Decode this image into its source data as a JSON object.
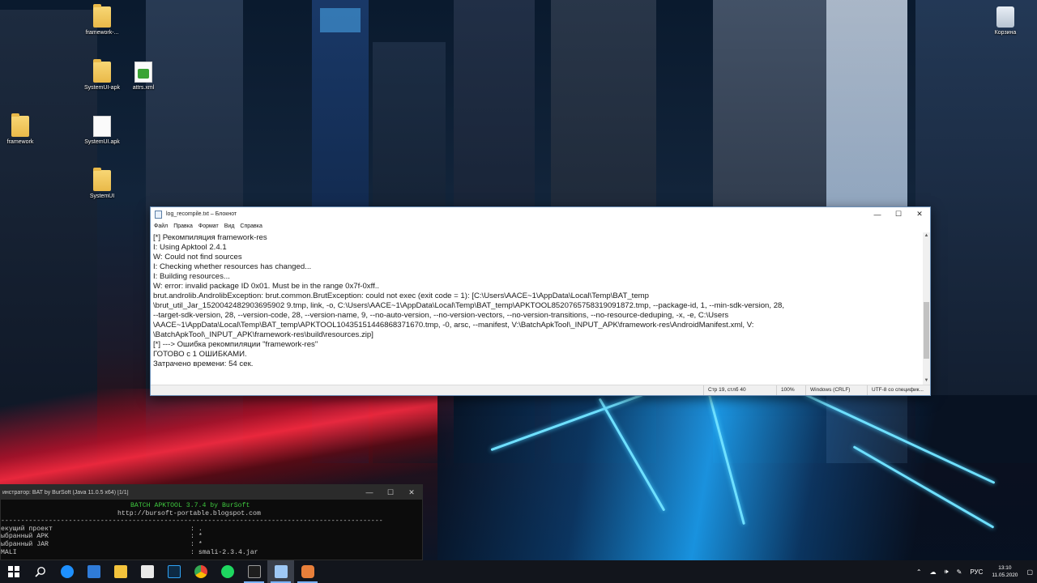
{
  "desktop": {
    "icons": [
      {
        "label": "framework-..."
      },
      {
        "label": "SystemUI-apk"
      },
      {
        "label": "attrs.xml"
      },
      {
        "label": "framework"
      },
      {
        "label": "SystemUI.apk"
      },
      {
        "label": "SystemUI"
      },
      {
        "label": "Корзина"
      }
    ]
  },
  "notepad": {
    "title": "log_recompile.txt – Блокнот",
    "controls": {
      "minimize": "—",
      "maximize": "☐",
      "close": "✕"
    },
    "menu": [
      "Файл",
      "Правка",
      "Формат",
      "Вид",
      "Справка"
    ],
    "lines": [
      "[*] Рекомпиляция framework-res",
      "I: Using Apktool 2.4.1",
      "W: Could not find sources",
      "I: Checking whether resources has changed...",
      "I: Building resources...",
      "W: error: invalid package ID 0x01. Must be in the range 0x7f-0xff..",
      "brut.androlib.AndrolibException: brut.common.BrutException: could not exec (exit code = 1): [C:\\Users\\AACE~1\\AppData\\Local\\Temp\\BAT_temp",
      "\\brut_util_Jar_1520042482903695902 9.tmp, link, -o, C:\\Users\\AACE~1\\AppData\\Local\\Temp\\BAT_temp\\APKTOOL8520765758319091872.tmp, --package-id, 1, --min-sdk-version, 28,",
      "--target-sdk-version, 28, --version-code, 28, --version-name, 9, --no-auto-version, --no-version-vectors, --no-version-transitions, --no-resource-deduping, -x, -e, C:\\Users",
      "\\AACE~1\\AppData\\Local\\Temp\\BAT_temp\\APKTOOL10435151446868371670.tmp, -0, arsc, --manifest, V:\\BatchApkTool\\_INPUT_APK\\framework-res\\AndroidManifest.xml, V:",
      "\\BatchApkTool\\_INPUT_APK\\framework-res\\build\\resources.zip]",
      "[*] ---> Ошибка рекомпиляции \"framework-res\"",
      "",
      "ГОТОВО с 1 ОШИБКАМИ.",
      "Затрачено времени: 54 сек."
    ],
    "status": {
      "position": "Стр 19, стлб 40",
      "zoom": "100%",
      "line_ending": "Windows (CRLF)",
      "encoding": "UTF-8 со специфик..."
    }
  },
  "console": {
    "title": "инстратор: BAT by BurSoft (Java 11.0.5 x64) [1/1]",
    "controls": {
      "minimize": "—",
      "maximize": "☐",
      "close": "✕"
    },
    "header1": "BATCH APKTOOL 3.7.4 by BurSoft",
    "header2": "http://bursoft-portable.blogspot.com",
    "separator": "------------------------------------------------------------------------------------------------",
    "rows": [
      {
        "key": "екущий проект",
        "value": ": ."
      },
      {
        "key": "ыбранный APK",
        "value": ": *"
      },
      {
        "key": "ыбранный JAR",
        "value": ": *"
      },
      {
        "key": "MALI",
        "value": ": smali-2.3.4.jar"
      }
    ]
  },
  "taskbar": {
    "apps": [
      {
        "name": "start-button",
        "color": "#ffffff"
      },
      {
        "name": "search-button",
        "color": "#ffffff"
      },
      {
        "name": "edge-browser",
        "color": "#1e90ff"
      },
      {
        "name": "mail-app",
        "color": "#2f7bd8"
      },
      {
        "name": "file-explorer",
        "color": "#f3c33c"
      },
      {
        "name": "store-app",
        "color": "#e9e9e9"
      },
      {
        "name": "photoshop",
        "color": "#2fa3f7"
      },
      {
        "name": "chrome",
        "color": "#e94335"
      },
      {
        "name": "spotify",
        "color": "#1ed760"
      },
      {
        "name": "console-app",
        "color": "#9a9a9a"
      },
      {
        "name": "notepad-app",
        "color": "#9ec8f5"
      },
      {
        "name": "apktool-app",
        "color": "#e87f3a"
      }
    ],
    "tray": {
      "lang": "РУС",
      "time": "13:10",
      "date": "11.05.2020"
    }
  }
}
